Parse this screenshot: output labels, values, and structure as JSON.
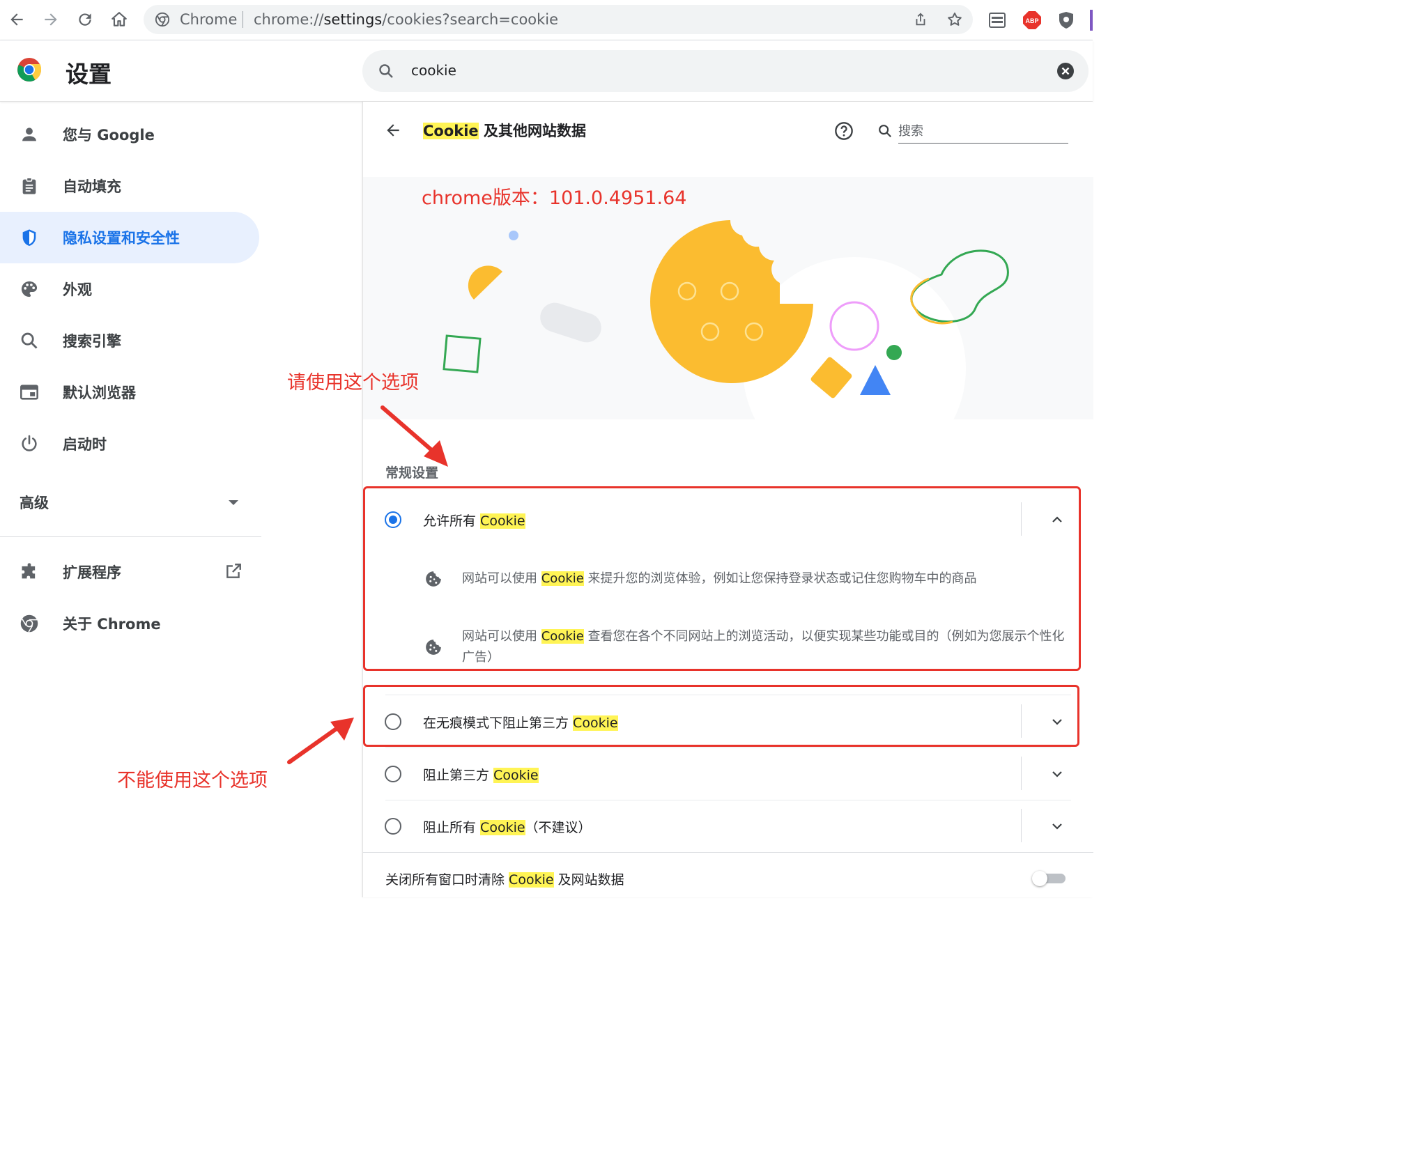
{
  "browser": {
    "site_chip": "Chrome",
    "url_prefix": "chrome://",
    "url_host": "settings",
    "url_rest": "/cookies?search=cookie",
    "ext_abp": "ABP"
  },
  "header": {
    "title": "设置",
    "search_value": "cookie"
  },
  "sidebar": {
    "items": [
      {
        "label": "您与 Google",
        "icon": "person-icon"
      },
      {
        "label": "自动填充",
        "icon": "clipboard-icon"
      },
      {
        "label": "隐私设置和安全性",
        "icon": "shield-icon"
      },
      {
        "label": "外观",
        "icon": "palette-icon"
      },
      {
        "label": "搜索引擎",
        "icon": "search-icon"
      },
      {
        "label": "默认浏览器",
        "icon": "browser-window-icon"
      },
      {
        "label": "启动时",
        "icon": "power-icon"
      }
    ],
    "advanced": "高级",
    "extensions": "扩展程序",
    "about": "关于 Chrome"
  },
  "main": {
    "title_highlight": "Cookie",
    "title_rest": " 及其他网站数据",
    "search_placeholder": "搜索",
    "version_note": "chrome版本：101.0.4951.64",
    "section_label": "常规设置",
    "options": [
      {
        "prefix": "允许所有 ",
        "highlight": "Cookie",
        "suffix": "",
        "selected": true
      },
      {
        "prefix": "在无痕模式下阻止第三方 ",
        "highlight": "Cookie",
        "suffix": "",
        "selected": false
      },
      {
        "prefix": "阻止第三方 ",
        "highlight": "Cookie",
        "suffix": "",
        "selected": false
      },
      {
        "prefix": "阻止所有 ",
        "highlight": "Cookie",
        "suffix": "（不建议）",
        "selected": false
      }
    ],
    "desc1": {
      "prefix": "网站可以使用 ",
      "highlight": "Cookie",
      "suffix": " 来提升您的浏览体验，例如让您保持登录状态或记住您购物车中的商品"
    },
    "desc2": {
      "prefix": "网站可以使用 ",
      "highlight": "Cookie",
      "suffix": " 查看您在各个不同网站上的浏览活动，以便实现某些功能或目的（例如为您展示个性化广告）"
    },
    "clear_on_exit": {
      "prefix": "关闭所有窗口时清除 ",
      "highlight": "Cookie",
      "suffix": " 及网站数据",
      "enabled": false
    }
  },
  "annotations": {
    "use_this": "请使用这个选项",
    "dont_use": "不能使用这个选项",
    "color": "#e8332b"
  },
  "colors": {
    "accent": "#1a73e8",
    "highlight": "#fff455",
    "cookie": "#fbbc30"
  }
}
